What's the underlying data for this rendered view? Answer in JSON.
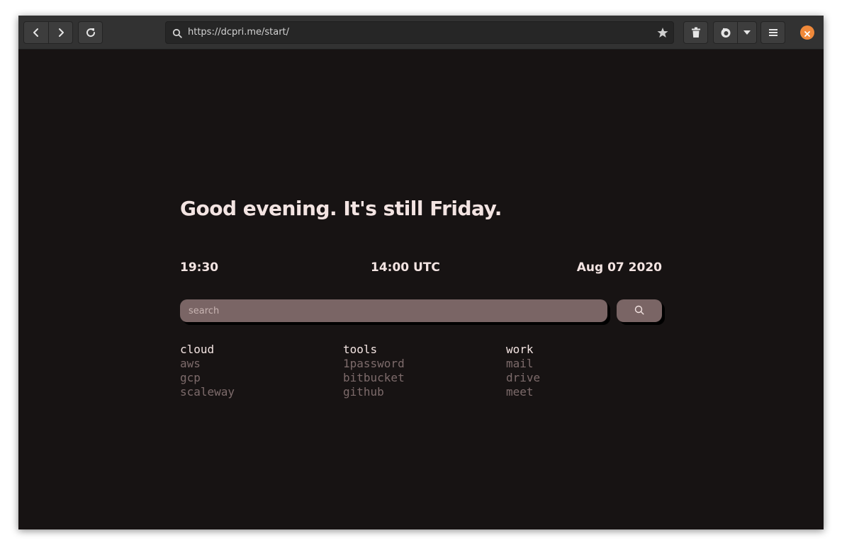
{
  "browser": {
    "url": "https://dcpri.me/start/",
    "icons": [
      "back-icon",
      "forward-icon",
      "reload-icon",
      "search-icon",
      "star-icon",
      "trash-icon",
      "firefox-icon",
      "dropdown-arrow-icon",
      "menu-icon",
      "close-icon"
    ],
    "close_color": "#f0893a"
  },
  "page": {
    "greeting": "Good evening. It's still Friday.",
    "local_time": "19:30",
    "utc_time": "14:00 UTC",
    "date": "Aug 07 2020",
    "search_placeholder": "search",
    "colors": {
      "background": "#171313",
      "text": "#f3e4e2",
      "accent": "#7a6565",
      "link": "#7d6b6b"
    }
  },
  "link_columns": [
    {
      "title": "cloud",
      "links": [
        "aws",
        "gcp",
        "scaleway"
      ]
    },
    {
      "title": "tools",
      "links": [
        "1password",
        "bitbucket",
        "github"
      ]
    },
    {
      "title": "work",
      "links": [
        "mail",
        "drive",
        "meet"
      ]
    }
  ]
}
